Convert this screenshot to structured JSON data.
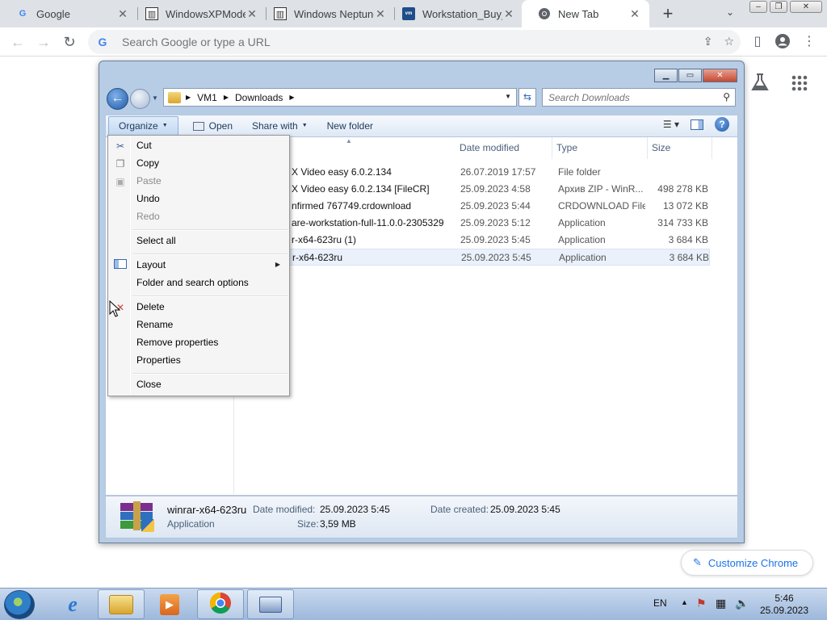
{
  "browser": {
    "tabs": [
      {
        "title": "Google",
        "icon": "google-icon"
      },
      {
        "title": "WindowsXPMode",
        "icon": "archive-icon"
      },
      {
        "title": "Windows Neptune",
        "icon": "archive-icon"
      },
      {
        "title": "Workstation_Buy_",
        "icon": "vmware-icon"
      },
      {
        "title": "New Tab",
        "icon": "chrome-icon",
        "active": true
      }
    ],
    "omnibox_placeholder": "Search Google or type a URL",
    "customize_label": "Customize Chrome"
  },
  "explorer": {
    "breadcrumb": [
      "VM1",
      "Downloads"
    ],
    "search_placeholder": "Search Downloads",
    "commands": {
      "organize": "Organize",
      "open": "Open",
      "share": "Share with",
      "new_folder": "New folder"
    },
    "columns": {
      "date": "Date modified",
      "type": "Type",
      "size": "Size"
    },
    "files": [
      {
        "name": "X Video easy 6.0.2.134",
        "date": "26.07.2019 17:57",
        "type": "File folder",
        "size": ""
      },
      {
        "name": "X Video easy 6.0.2.134 [FileCR]",
        "date": "25.09.2023 4:58",
        "type": "Архив ZIP - WinR...",
        "size": "498 278 KB"
      },
      {
        "name": "nfirmed 767749.crdownload",
        "date": "25.09.2023 5:44",
        "type": "CRDOWNLOAD File",
        "size": "13 072 KB"
      },
      {
        "name": "are-workstation-full-11.0.0-2305329",
        "date": "25.09.2023 5:12",
        "type": "Application",
        "size": "314 733 KB"
      },
      {
        "name": "r-x64-623ru (1)",
        "date": "25.09.2023 5:45",
        "type": "Application",
        "size": "3 684 KB"
      },
      {
        "name": "r-x64-623ru",
        "date": "25.09.2023 5:45",
        "type": "Application",
        "size": "3 684 KB"
      }
    ],
    "details": {
      "filename": "winrar-x64-623ru",
      "type": "Application",
      "date_modified_label": "Date modified:",
      "date_modified": "25.09.2023 5:45",
      "date_created_label": "Date created:",
      "date_created": "25.09.2023 5:45",
      "size_label": "Size:",
      "size": "3,59 MB"
    }
  },
  "context_menu": {
    "cut": "Cut",
    "copy": "Copy",
    "paste": "Paste",
    "undo": "Undo",
    "redo": "Redo",
    "select_all": "Select all",
    "layout": "Layout",
    "folder_options": "Folder and search options",
    "delete": "Delete",
    "rename": "Rename",
    "remove_properties": "Remove properties",
    "properties": "Properties",
    "close": "Close"
  },
  "taskbar": {
    "language": "EN",
    "time": "5:46",
    "date": "25.09.2023"
  },
  "colors": {
    "chrome_tabstrip": "#dee1e6",
    "chrome_accent": "#1a73e8",
    "explorer_frame": "#b7cde6",
    "taskbar": "#b7cbe6"
  }
}
